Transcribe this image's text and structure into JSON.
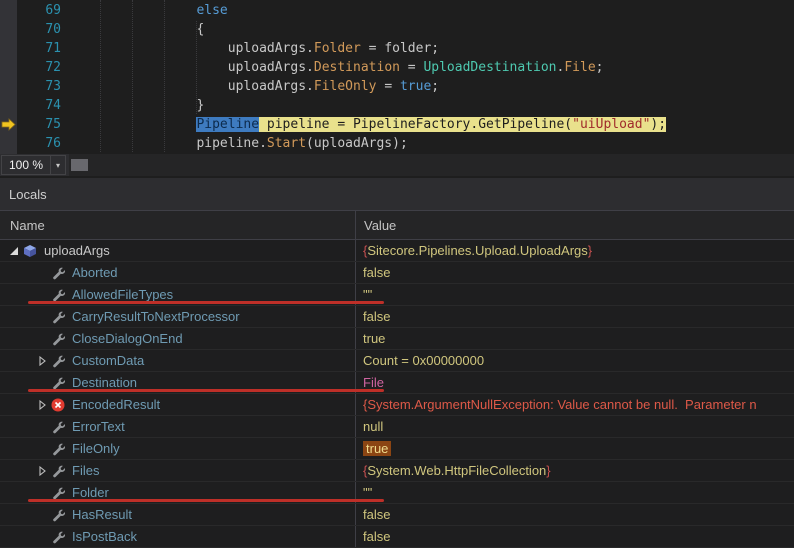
{
  "colors": {
    "current_statement_highlight": "#E9E18C",
    "selection_blue": "#3E7BC0",
    "annotation_red": "#BE2F28",
    "changed_value_bg": "#8B4513",
    "error_red": "#DE5948",
    "value_yellow": "#D0C67E",
    "name_teal": "#6F9BB3",
    "line_number_blue": "#2B91AF",
    "keyword_blue": "#569CD6",
    "type_teal": "#4EC9B0"
  },
  "editor": {
    "zoom": "100 %",
    "lines": [
      {
        "num": 69,
        "pad": 15,
        "tokens": [
          {
            "t": "else",
            "c": "kw"
          }
        ]
      },
      {
        "num": 70,
        "pad": 15,
        "tokens": [
          {
            "t": "{",
            "c": "pl"
          }
        ]
      },
      {
        "num": 71,
        "pad": 19,
        "tokens": [
          {
            "t": "uploadArgs",
            "c": "id"
          },
          {
            "t": ".",
            "c": "pl"
          },
          {
            "t": "Folder",
            "c": "mem"
          },
          {
            "t": " = ",
            "c": "pl"
          },
          {
            "t": "folder",
            "c": "id"
          },
          {
            "t": ";",
            "c": "pl"
          }
        ]
      },
      {
        "num": 72,
        "pad": 19,
        "tokens": [
          {
            "t": "uploadArgs",
            "c": "id"
          },
          {
            "t": ".",
            "c": "pl"
          },
          {
            "t": "Destination",
            "c": "mem"
          },
          {
            "t": " = ",
            "c": "pl"
          },
          {
            "t": "UploadDestination",
            "c": "type"
          },
          {
            "t": ".",
            "c": "pl"
          },
          {
            "t": "File",
            "c": "mem"
          },
          {
            "t": ";",
            "c": "pl"
          }
        ]
      },
      {
        "num": 73,
        "pad": 19,
        "tokens": [
          {
            "t": "uploadArgs",
            "c": "id"
          },
          {
            "t": ".",
            "c": "pl"
          },
          {
            "t": "FileOnly",
            "c": "mem"
          },
          {
            "t": " = ",
            "c": "pl"
          },
          {
            "t": "true",
            "c": "kw"
          },
          {
            "t": ";",
            "c": "pl"
          }
        ]
      },
      {
        "num": 74,
        "pad": 15,
        "tokens": [
          {
            "t": "}",
            "c": "pl"
          }
        ]
      },
      {
        "num": 75,
        "pad": 15,
        "current": true,
        "tokens": [
          {
            "t": "Pipeline",
            "c": "type sel"
          },
          {
            "t": " pipeline = PipelineFactory.GetPipeline(",
            "c": "hl"
          },
          {
            "t": "\"uiUpload\"",
            "c": "hlstr"
          },
          {
            "t": ");",
            "c": "hl"
          }
        ]
      },
      {
        "num": 76,
        "pad": 15,
        "tokens": [
          {
            "t": "pipeline",
            "c": "id"
          },
          {
            "t": ".",
            "c": "pl"
          },
          {
            "t": "Start",
            "c": "mem"
          },
          {
            "t": "(",
            "c": "pl"
          },
          {
            "t": "uploadArgs",
            "c": "id"
          },
          {
            "t": ");",
            "c": "pl"
          }
        ]
      }
    ]
  },
  "locals": {
    "title": "Locals",
    "columns": [
      "Name",
      "Value"
    ],
    "rows": [
      {
        "name": "uploadArgs",
        "level": 0,
        "expand": "expanded",
        "icon": "object",
        "value": [
          {
            "t": "{",
            "c": "brace"
          },
          {
            "t": "Sitecore.Pipelines.Upload.UploadArgs",
            "c": "val"
          },
          {
            "t": "}",
            "c": "brace"
          }
        ]
      },
      {
        "name": "Aborted",
        "level": 1,
        "icon": "property",
        "value": [
          {
            "t": "false",
            "c": "val"
          }
        ]
      },
      {
        "name": "AllowedFileTypes",
        "level": 1,
        "icon": "property",
        "annotated": true,
        "value": [
          {
            "t": "\"\"",
            "c": "val"
          }
        ]
      },
      {
        "name": "CarryResultToNextProcessor",
        "level": 1,
        "icon": "property",
        "value": [
          {
            "t": "false",
            "c": "val"
          }
        ]
      },
      {
        "name": "CloseDialogOnEnd",
        "level": 1,
        "icon": "property",
        "value": [
          {
            "t": "true",
            "c": "val"
          }
        ]
      },
      {
        "name": "CustomData",
        "level": 1,
        "expand": "collapsed",
        "icon": "property",
        "value": [
          {
            "t": "Count = 0x00000000",
            "c": "val"
          }
        ]
      },
      {
        "name": "Destination",
        "level": 1,
        "icon": "property",
        "annotated": true,
        "value": [
          {
            "t": "File",
            "c": "enum"
          }
        ]
      },
      {
        "name": "EncodedResult",
        "level": 1,
        "expand": "collapsed",
        "icon": "error",
        "value": [
          {
            "t": "{System.ArgumentNullException: Value cannot be null.  Parameter n",
            "c": "err"
          }
        ]
      },
      {
        "name": "ErrorText",
        "level": 1,
        "icon": "property",
        "value": [
          {
            "t": "null",
            "c": "val"
          }
        ]
      },
      {
        "name": "FileOnly",
        "level": 1,
        "icon": "property",
        "value": [
          {
            "t": "true",
            "c": "val changed"
          }
        ]
      },
      {
        "name": "Files",
        "level": 1,
        "expand": "collapsed",
        "icon": "property",
        "value": [
          {
            "t": "{",
            "c": "brace"
          },
          {
            "t": "System.Web.HttpFileCollection",
            "c": "val"
          },
          {
            "t": "}",
            "c": "brace"
          }
        ]
      },
      {
        "name": "Folder",
        "level": 1,
        "icon": "property",
        "annotated": true,
        "value": [
          {
            "t": "\"\"",
            "c": "val"
          }
        ]
      },
      {
        "name": "HasResult",
        "level": 1,
        "icon": "property",
        "value": [
          {
            "t": "false",
            "c": "val"
          }
        ]
      },
      {
        "name": "IsPostBack",
        "level": 1,
        "icon": "property",
        "value": [
          {
            "t": "false",
            "c": "val"
          }
        ]
      }
    ]
  }
}
